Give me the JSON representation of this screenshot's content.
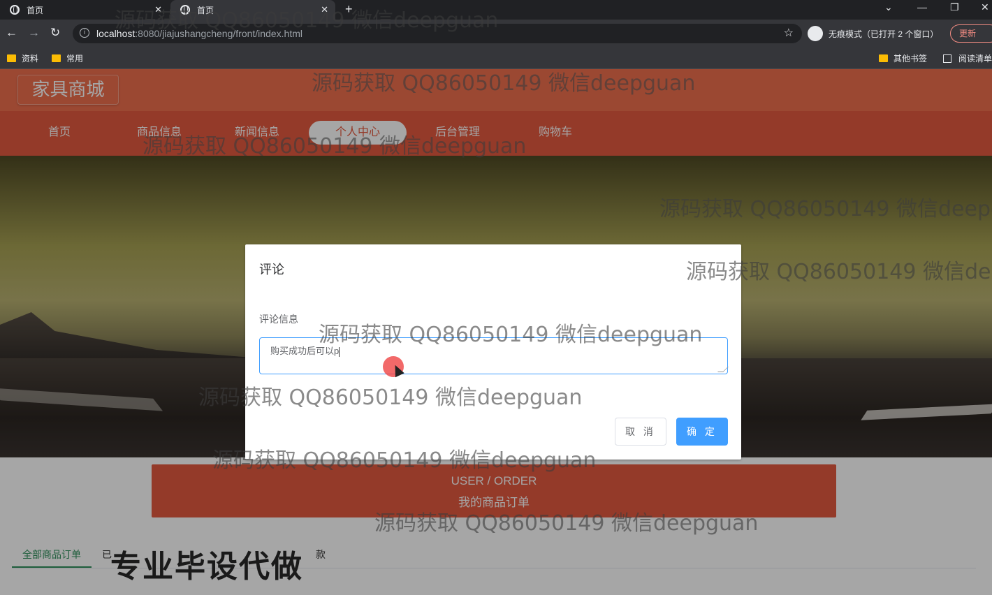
{
  "browser": {
    "tabs": [
      {
        "title": "首页",
        "active": false
      },
      {
        "title": "首页",
        "active": true
      }
    ],
    "url_host": "localhost",
    "url_rest": ":8080/jiajushangcheng/front/index.html",
    "incognito_label": "无痕模式（已打开 2 个窗口）",
    "update_label": "更新",
    "bookmarks": [
      "资料",
      "常用"
    ],
    "bookmarks_right": [
      "其他书签",
      "阅读清单"
    ]
  },
  "site": {
    "logo": "家具商城",
    "nav": [
      "首页",
      "商品信息",
      "新闻信息",
      "个人中心",
      "后台管理",
      "购物车"
    ],
    "nav_active": "个人中心"
  },
  "order_banner": {
    "en": "USER / ORDER",
    "zh": "我的商品订单"
  },
  "order_tabs": [
    "全部商品订单",
    "已",
    "款"
  ],
  "dialog": {
    "title": "评论",
    "field_label": "评论信息",
    "textarea_value": "购买成功后可以p",
    "cancel_label": "取 消",
    "ok_label": "确 定"
  },
  "overlay_text": {
    "watermark": "源码获取 QQ86050149 微信deepguan",
    "promo": "专业毕设代做"
  },
  "colors": {
    "header": "#ef6f4e",
    "nav": "#e45a3f",
    "primary": "#409eff",
    "tab_active": "#2f8f5b"
  }
}
